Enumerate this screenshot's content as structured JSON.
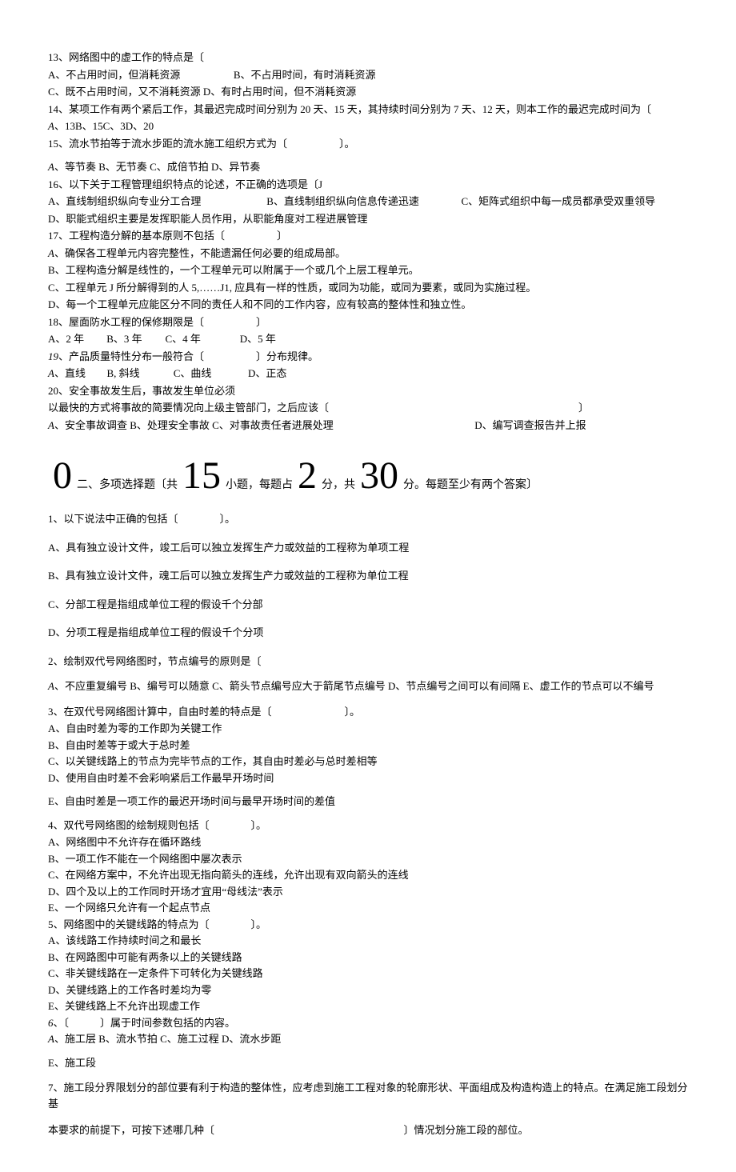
{
  "q13": {
    "stem": "13、网络图中的虚工作的特点是〔",
    "a": "A、不占用时间，但消耗资源",
    "b": "B、不占用时间，有时消耗资源",
    "c": "C、既不占用时间，又不消耗资源",
    "d": "D、有时占用时间，但不消耗资源"
  },
  "q14": {
    "stem": "14、某项工作有两个紧后工作，其最迟完成时间分别为 20 天、15 天，其持续时间分别为 7 天、12 天，则本工作的最迟完成时间为〔",
    "opts": "、13B、15C、3D、20",
    "optA": "A"
  },
  "q15": {
    "stem": "15、流水节拍等于流水步距的流水施工组织方式为〔　　　　　〕。"
  },
  "q15opts": {
    "a": "A",
    "text": "、等节奏 B、无节奏 C、成倍节拍 D、异节奏"
  },
  "q16": {
    "stem": "16、以下关于工程管理组织特点的论述，不正确的选项是〔J",
    "a": "A、直线制组织纵向专业分工合理",
    "b": "B、直线制组织纵向信息传递迅速",
    "c": "C、矩阵式组织中每一成员都承受双重领导",
    "d": "D、职能式组织主要是发挥职能人员作用，从职能角度对工程进展管理"
  },
  "q17": {
    "stem": "17、工程构造分解的基本原则不包括〔　　　　　〕",
    "a": "、确保各工程单元内容完整性，不能遗漏任何必要的组成局部。",
    "aA": "A",
    "b": "B、工程构造分解是线性的，一个工程单元可以附属于一个或几个上层工程单元。",
    "c": "C、工程单元 J 所分解得到的人 5,……J1, 应具有一样的性质，或同为功能，或同为要素，或同为实施过程。",
    "d": "D、每一个工程单元应能区分不同的责任人和不同的工作内容，应有较高的整体性和独立性。"
  },
  "q18": {
    "stem": "18、屋面防水工程的保修期限是〔　　　　　〕",
    "a": "A、2 年",
    "b": "B、3 年",
    "c": "C、4 年",
    "d": "D、5 年"
  },
  "q19": {
    "num": "19",
    "stem": "、产品质量特性分布一般符合〔　　　　　〕分布规律。",
    "aA": "A",
    "a": "、直线",
    "b": "B, 斜线",
    "c": "C、曲线",
    "d": "D、正态"
  },
  "q20": {
    "stem": "20、安全事故发生后，事故发生单位必须",
    "cont": "以最快的方式将事故的简要情况向上级主管部门，之后应该〔　　　　　　　　　　　　　　　　　　　　　　　　〕",
    "aA": "A",
    "a": "、安全事故调查 B、处理安全事故 C、对事故责任者进展处理",
    "d": "D、编写调查报告并上报"
  },
  "section2": {
    "zero": "0",
    "t1": "二、多项选择题〔共",
    "n1": "15",
    "t2": "小题，每题占",
    "n2": "2",
    "t3": "分，共",
    "n3": "30",
    "t4": "分。每题至少有两个答案〕"
  },
  "m1": {
    "stem": "1、以下说法中正确的包括〔　　　　〕。",
    "a": "A、具有独立设计文件，竣工后可以独立发挥生产力或效益的工程称为单项工程",
    "b": "B、具有独立设计文件，魂工后可以独立发挥生产力或效益的工程称为单位工程",
    "c": "C、分部工程是指组成单位工程的假设千个分部",
    "d": "D、分项工程是指组成单位工程的假设千个分项"
  },
  "m2": {
    "stem": "2、绘制双代号网络图时，节点编号的原则是〔",
    "aA": "A",
    "opts": "、不应重复编号 B、编号可以随意 C、箭头节点编号应大于箭尾节点编号 D、节点编号之间可以有间隔 E、虚工作的节点可以不编号"
  },
  "m3": {
    "stem": "3、在双代号网络图计算中，自由时差的特点是〔　　　　　　　〕。",
    "a": "A、自由时差为零的工作即为关键工作",
    "b": "B、自由时差等于或大于总时差",
    "c": "C、以关键线路上的节点为完毕节点的工作，其自由时差必与总时差相等",
    "d": "D、使用自由时差不会彩响紧后工作最早开场时间",
    "e": "E、自由时差是一项工作的最迟开场时间与最早开场时间的差值"
  },
  "m4": {
    "stem": "4、双代号网络图的绘制规则包括〔　　　　〕。",
    "a": "A、网络图中不允许存在循环路线",
    "b": "B、一项工作不能在一个网络图中屡次表示",
    "c": "C、在网络方案中，不允许出现无指向箭头的连线，允许出现有双向箭头的连线",
    "d": "D、四个及以上的工作同时开场才宜用“母线法”表示",
    "e": "E、一个网络只允许有一个起点节点"
  },
  "m5": {
    "stem": "5、网络图中的关键线路的特点为〔　　　　〕。",
    "a": "A、该线路工作持续时间之和最长",
    "b": "B、在网路图中可能有两条以上的关键线路",
    "c": "C、非关键线路在一定条件下可转化为关键线路",
    "d": "D、关键线路上的工作各时差均为零",
    "e": "E、关键线路上不允许出现虚工作"
  },
  "m6": {
    "num": "6",
    "stem": "、〔　　　〕属于时间参数包括的内容。",
    "aA": "A",
    "opts": "、施工层 B、流水节拍 C、施工过程 D、流水步距",
    "e": "E、施工段"
  },
  "m7": {
    "stem1": "7、施工段分界限划分的部位要有利于构造的整体性，应考虑到施工工程对象的轮廓形状、平面组成及构造构造上的特点。在满足施工段划分基",
    "stem2a": "本要求的前提下，可按下述哪几种〔",
    "stem2b": "〕情况划分施工段的部位。"
  }
}
